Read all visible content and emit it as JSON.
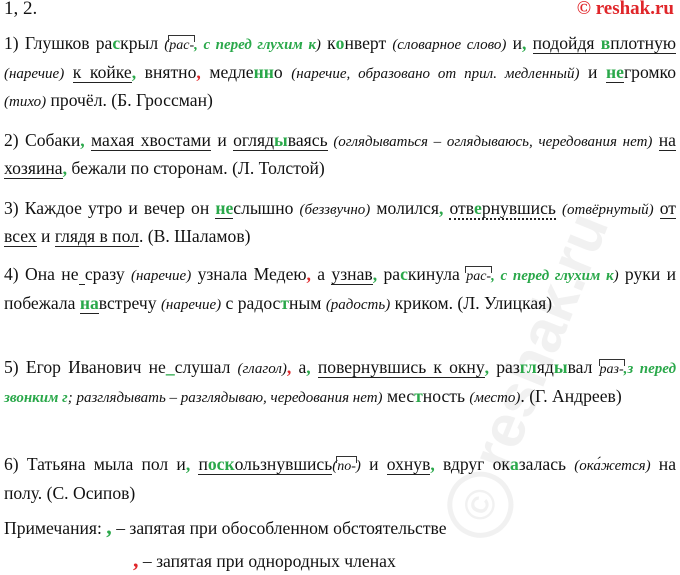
{
  "header": {
    "exercise": "1, 2.",
    "source": "© reshak.ru"
  },
  "watermark": "reshak.ru",
  "s1": {
    "a": "1) Глушков ра",
    "a_g": "с",
    "a2": "крыл ",
    "n1": "(",
    "n1_box": "рас-",
    "n1_g": ", с перед глухим к",
    "n1_end": ")",
    "b": " к",
    "b_g": "о",
    "b2": "нверт ",
    "n2": "(словарное слово)",
    "c": " и",
    "comma1": ",",
    "d": "подойдя ",
    "d_u1": "",
    "d_u2": "в",
    "d_u3": "плотную",
    "n3": "(наречие)",
    "e": "к койке",
    "comma2": ",",
    "f": " внятно",
    "comma3": ",",
    "f2": " медле",
    "f_g": "нн",
    "f3": "о ",
    "n4": "(наречие, образовано от прил. медленный)",
    "g": " и ",
    "g_g": "не",
    "g2": "громко ",
    "n5": "(тихо)",
    "h": " прочёл. (Б. Гроссман)"
  },
  "s2": {
    "a": "2) Собаки",
    "comma1": ",",
    "b1": "махая хвостами",
    "b": " и ",
    "c1": "огляд",
    "c_g": "ы",
    "c2": "ваясь",
    "n1": " (оглядываться – оглядываюсь, чередования нет)",
    "d": "на хозяина",
    "comma2": ",",
    "e": " бежали по сторонам. (Л. Толстой)"
  },
  "s3": {
    "a": "3) Каждое утро и вечер он ",
    "a_g": "не",
    "a2": "слышно ",
    "n1": "(беззвучно)",
    "b": " молился",
    "comma1": ",",
    "c1": "отв",
    "c_g": "е",
    "c2": "рнувшись",
    "n2": "(отвёрнутый)",
    "d": "от всех",
    "e": " и ",
    "f": "глядя в пол",
    "g": ". (В. Шаламов)"
  },
  "s4": {
    "a": "4) Она не",
    "a_g": " ",
    "a2": "сразу ",
    "n1": "(наречие)",
    "b": " узнала Медею",
    "comma1": ",",
    "c": " а ",
    "d": "узнав",
    "comma2": ",",
    "e": " ра",
    "e_g": "с",
    "e2": "кинула ",
    "n2_box": "рас-",
    "n2_g": ", с перед глухим к",
    "n2_end": ")",
    "f": " руки и побежала ",
    "f_g": "на",
    "f2": "встречу ",
    "n3": "(наречие)",
    "g": " с радос",
    "g_g": "т",
    "g2": "ным ",
    "n4": "(радость)",
    "h": " криком. (Л. Улицкая)"
  },
  "s5": {
    "a": "5) Егор Иванович не",
    "a_g": "_",
    "a2": "слушал ",
    "n1": "(глагол)",
    "comma1": ",",
    "b": " а",
    "comma2": ",",
    "c": "повернувшись к окну",
    "comma3": ",",
    "d": "раз",
    "d_g": "гл",
    "d2": "яд",
    "d_g2": "ы",
    "d3": "вал ",
    "n2_box": "раз-",
    "n2_g": ",з перед звонким г",
    "n2_end": ";",
    "n3": " разглядывать – разглядываю,",
    "n4": " чередования нет)",
    "e": " мес",
    "e_g": "т",
    "e2": "ность ",
    "n5": "(место)",
    "f": ". (Г. Андреев)"
  },
  "s6": {
    "a": "6) Татьяна мыла пол и",
    "comma1": ",",
    "b1": "п",
    "b_g": "оск",
    "b2": "ользнувшись",
    "n1_box": "по-",
    "n1_end": ")",
    "c": " и ",
    "d": "охнув",
    "comma2": ",",
    "e": " вдруг ок",
    "e_g": "а",
    "e2": "залась",
    "n2": "(ока́жется)",
    "f": " на полу. (С. Осипов)"
  },
  "notes": {
    "label": "Примечания: ",
    "green_mark": ",",
    "green_text": " – запятая при обособленном обстоятельстве",
    "red_mark": ",",
    "red_text": " – запятая при однородных членах"
  },
  "colors": {
    "green": "#2aa84a",
    "red": "#e0262a"
  }
}
